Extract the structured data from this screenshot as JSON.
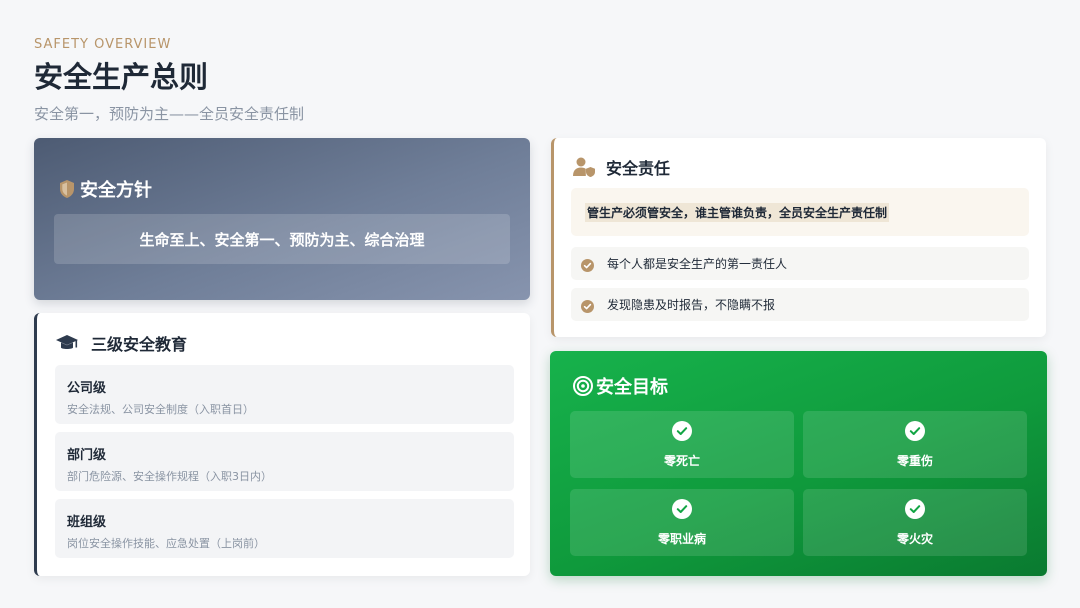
{
  "header": {
    "eyebrow": "SAFETY OVERVIEW",
    "title": "安全生产总则",
    "subtitle": "安全第一，预防为主——全员安全责任制"
  },
  "policy": {
    "title": "安全方针",
    "statement": "生命至上、安全第一、预防为主、综合治理",
    "icon": "shield-icon"
  },
  "education": {
    "title": "三级安全教育",
    "icon": "graduation-cap-icon",
    "levels": [
      {
        "name": "公司级",
        "desc": "安全法规、公司安全制度（入职首日）"
      },
      {
        "name": "部门级",
        "desc": "部门危险源、安全操作规程（入职3日内）"
      },
      {
        "name": "班组级",
        "desc": "岗位安全操作技能、应急处置（上岗前）"
      }
    ]
  },
  "responsibility": {
    "title": "安全责任",
    "icon": "user-shield-icon",
    "principle": "管生产必须管安全，谁主管谁负责，全员安全生产责任制",
    "items": [
      "每个人都是安全生产的第一责任人",
      "发现隐患及时报告，不隐瞒不报"
    ]
  },
  "goals": {
    "title": "安全目标",
    "icon": "target-icon",
    "items": [
      "零死亡",
      "零重伤",
      "零职业病",
      "零火灾"
    ]
  },
  "colors": {
    "accent_gold": "#b8956a",
    "navy": "#2e3b4e",
    "green": "#12a544"
  }
}
